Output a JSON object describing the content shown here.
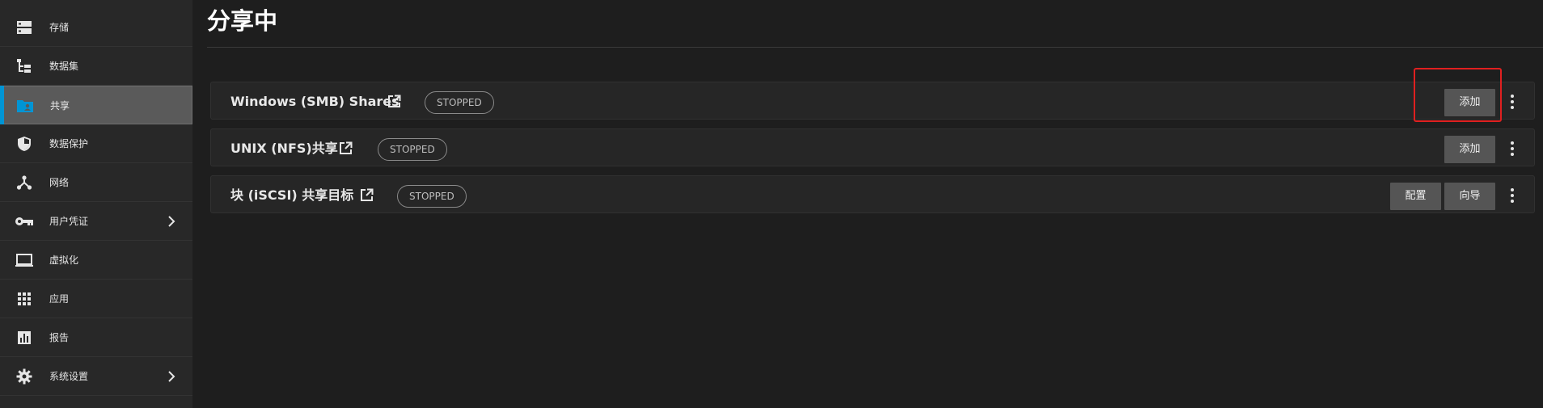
{
  "sidebar": {
    "items": [
      {
        "label": "存储",
        "icon": "storage-icon"
      },
      {
        "label": "数据集",
        "icon": "datasets-tree-icon"
      },
      {
        "label": "共享",
        "icon": "shares-folder-icon",
        "active": true
      },
      {
        "label": "数据保护",
        "icon": "shield-icon"
      },
      {
        "label": "网络",
        "icon": "network-icon"
      },
      {
        "label": "用户凭证",
        "icon": "key-icon",
        "expandable": true
      },
      {
        "label": "虚拟化",
        "icon": "laptop-icon"
      },
      {
        "label": "应用",
        "icon": "apps-grid-icon"
      },
      {
        "label": "报告",
        "icon": "chart-icon"
      },
      {
        "label": "系统设置",
        "icon": "gear-icon",
        "expandable": true
      }
    ]
  },
  "page": {
    "title": "分享中"
  },
  "cards": [
    {
      "title": "Windows (SMB) Shares",
      "status": "STOPPED",
      "buttons": [
        "添加"
      ]
    },
    {
      "title": "UNIX (NFS)共享",
      "status": "STOPPED",
      "buttons": [
        "添加"
      ]
    },
    {
      "title": "块 (iSCSI) 共享目标",
      "status": "STOPPED",
      "buttons": [
        "配置",
        "向导"
      ]
    }
  ],
  "colors": {
    "accent": "#0095d5",
    "highlight": "#e02020",
    "background": "#1e1e1e",
    "sidebar": "#282828"
  }
}
